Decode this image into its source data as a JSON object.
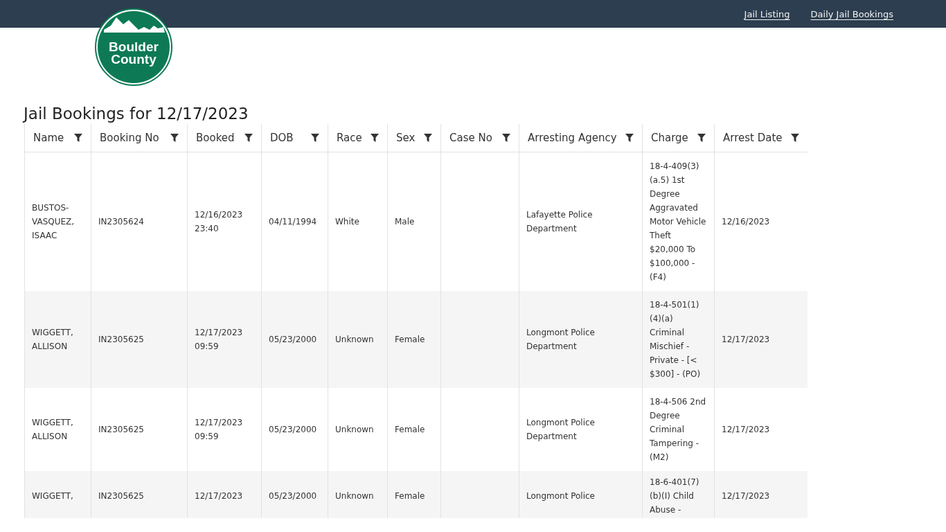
{
  "nav": {
    "links": [
      "Jail Listing",
      "Daily Jail Bookings"
    ]
  },
  "logo": {
    "lines": [
      "Boulder",
      "County"
    ]
  },
  "title": "Jail Bookings for 12/17/2023",
  "table": {
    "columns": [
      "Name",
      "Booking No",
      "Booked",
      "DOB",
      "Race",
      "Sex",
      "Case No",
      "Arresting Agency",
      "Charge",
      "Arrest Date"
    ],
    "rows": [
      {
        "cells": [
          "BUSTOS-VASQUEZ, ISAAC",
          "IN2305624",
          "12/16/2023 23:40",
          "04/11/1994",
          "White",
          "Male",
          "",
          "Lafayette Police Department",
          "18-4-409(3)(a.5) 1st Degree Aggravated Motor Vehicle Theft $20,000 To $100,000 - (F4)",
          "12/16/2023"
        ]
      },
      {
        "cells": [
          "WIGGETT, ALLISON",
          "IN2305625",
          "12/17/2023 09:59",
          "05/23/2000",
          "Unknown",
          "Female",
          "",
          "Longmont Police Department",
          "18-4-501(1)(4)(a) Criminal Mischief - Private - [< $300] - (PO)",
          "12/17/2023"
        ]
      },
      {
        "cells": [
          "WIGGETT, ALLISON",
          "IN2305625",
          "12/17/2023 09:59",
          "05/23/2000",
          "Unknown",
          "Female",
          "",
          "Longmont Police Department",
          "18-4-506 2nd Degree Criminal Tampering - (M2)",
          "12/17/2023"
        ]
      },
      {
        "cells": [
          "WIGGETT,",
          "IN2305625",
          "12/17/2023",
          "05/23/2000",
          "Unknown",
          "Female",
          "",
          "Longmont Police",
          "18-6-401(7)(b)(I) Child Abuse -",
          "12/17/2023"
        ]
      }
    ]
  }
}
